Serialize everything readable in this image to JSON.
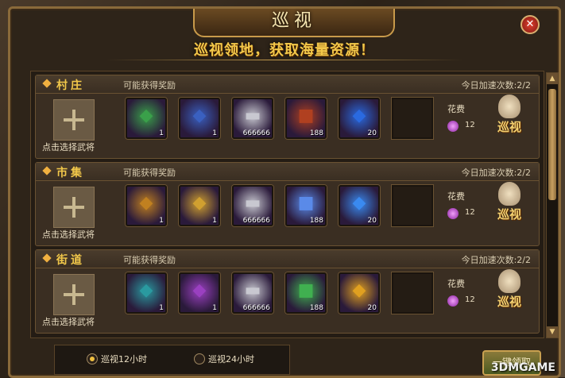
{
  "window": {
    "title": "巡视",
    "close_label": "✕"
  },
  "banner": "巡视领地，获取海量资源！",
  "rows": [
    {
      "zone": "村庄",
      "reward_label": "可能获得奖励",
      "speedup": "今日加速次数:2/2",
      "select_general": "点击选择武将",
      "items": [
        {
          "name": "green-jade",
          "count": "1",
          "color": "#3aa04a"
        },
        {
          "name": "blue-jade",
          "count": "1",
          "color": "#3a60c0"
        },
        {
          "name": "silver-ingot",
          "count": "666666",
          "color": "#c8c8d0"
        },
        {
          "name": "treasure-box",
          "count": "188",
          "color": "#b04020"
        },
        {
          "name": "blue-gem",
          "count": "20",
          "color": "#2a6ae0"
        }
      ],
      "cost_label": "花费",
      "cost": "12",
      "patrol_label": "巡视"
    },
    {
      "zone": "市集",
      "reward_label": "可能获得奖励",
      "speedup": "今日加速次数:2/2",
      "select_general": "点击选择武将",
      "items": [
        {
          "name": "gold-chest",
          "count": "1",
          "color": "#c08020"
        },
        {
          "name": "gold-key",
          "count": "1",
          "color": "#d0a030"
        },
        {
          "name": "silver-ingot",
          "count": "666666",
          "color": "#c8c8d0"
        },
        {
          "name": "blue-crystal",
          "count": "188",
          "color": "#5a8ae8"
        },
        {
          "name": "blue-shard",
          "count": "20",
          "color": "#3a8af0"
        }
      ],
      "cost_label": "花费",
      "cost": "12",
      "patrol_label": "巡视"
    },
    {
      "zone": "街道",
      "reward_label": "可能获得奖励",
      "speedup": "今日加速次数:2/2",
      "select_general": "点击选择武将",
      "items": [
        {
          "name": "teal-stone",
          "count": "1",
          "color": "#2a9aa0"
        },
        {
          "name": "purple-feather",
          "count": "1",
          "color": "#9a40c0"
        },
        {
          "name": "silver-ingot",
          "count": "666666",
          "color": "#c8c8d0"
        },
        {
          "name": "green-orb",
          "count": "188",
          "color": "#40b050"
        },
        {
          "name": "gold-orb",
          "count": "20",
          "color": "#e0a020"
        }
      ],
      "cost_label": "花费",
      "cost": "12",
      "patrol_label": "巡视"
    }
  ],
  "options": [
    {
      "label": "巡视12小时",
      "selected": true
    },
    {
      "label": "巡视24小时",
      "selected": false
    }
  ],
  "claim_label": "一键领取",
  "watermark": "3DMGAME"
}
